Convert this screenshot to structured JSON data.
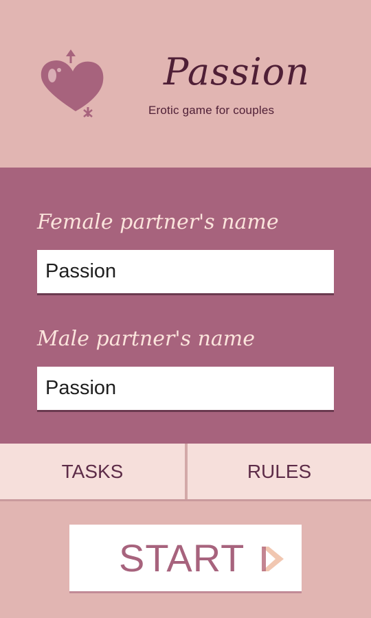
{
  "header": {
    "title": "Passion",
    "subtitle": "Erotic game for couples",
    "logo_icon": "heart-gender-icon"
  },
  "form": {
    "female_label": "Female partner's name",
    "female_value": "Passion",
    "male_label": "Male partner's name",
    "male_value": "Passion"
  },
  "tabs": {
    "tasks_label": "TASKS",
    "rules_label": "RULES"
  },
  "start": {
    "label": "START",
    "icon": "chevron-right-icon"
  },
  "colors": {
    "background": "#e1b5b2",
    "panel": "#a7637d",
    "tab_bar": "#f6dfdb",
    "title_text": "#4f1f36",
    "accent": "#a7637d"
  }
}
